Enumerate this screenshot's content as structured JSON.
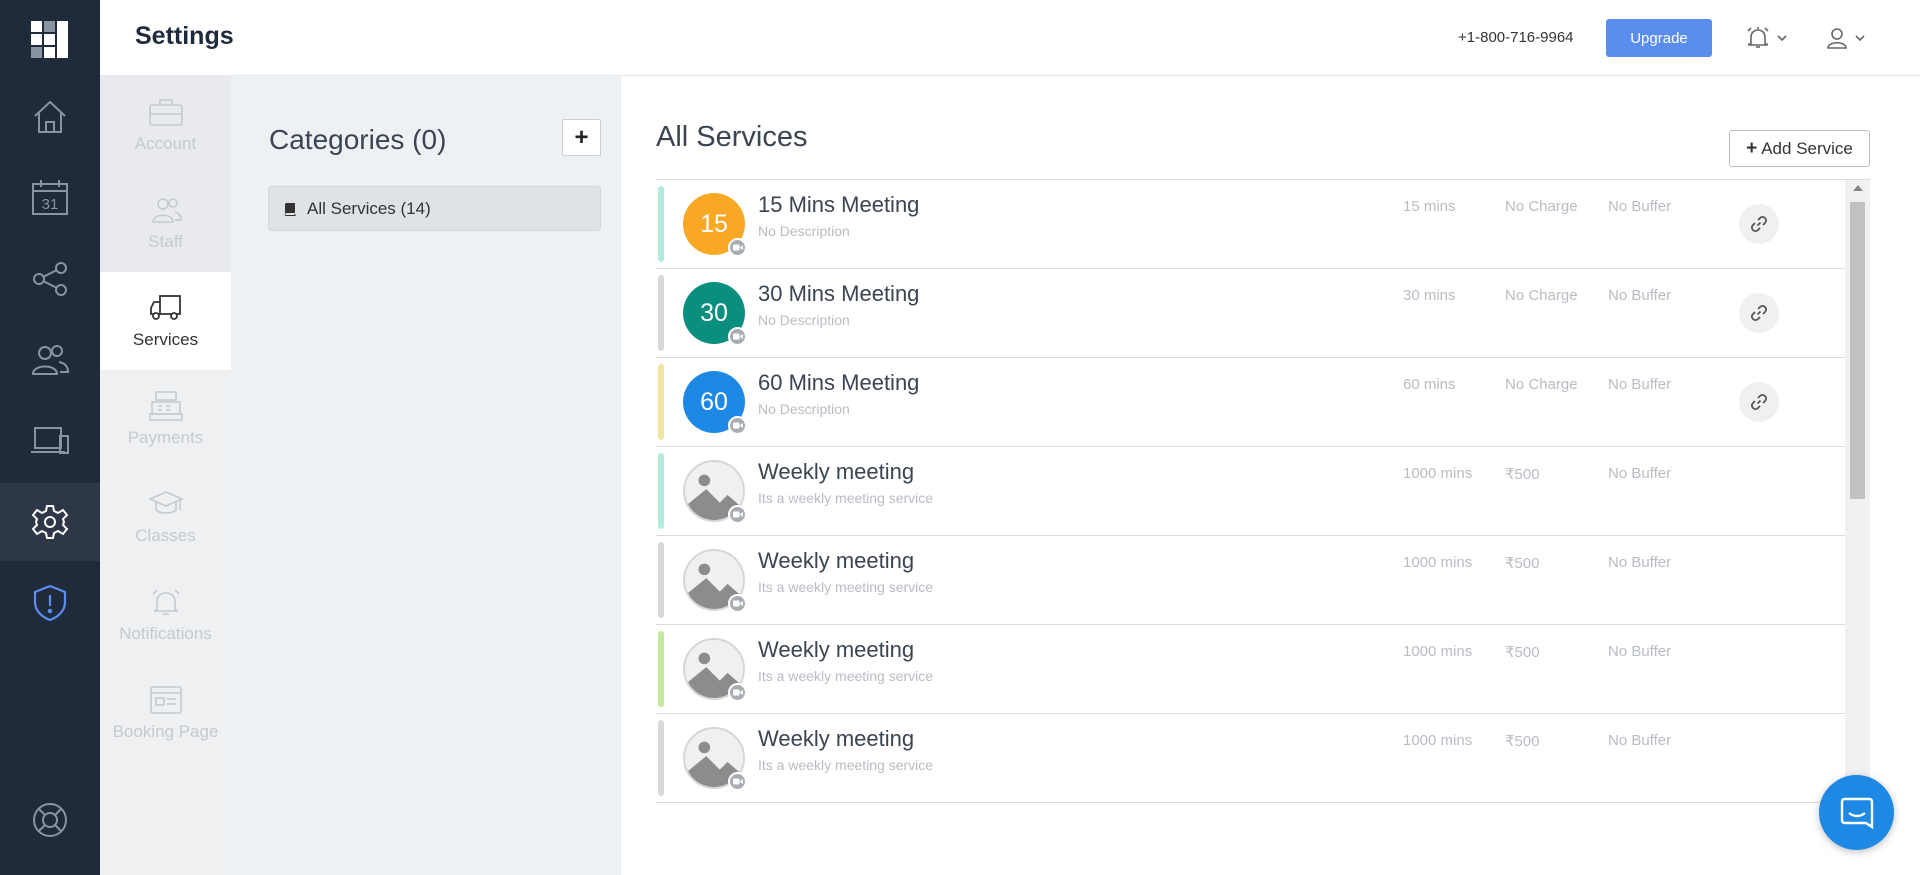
{
  "header": {
    "title": "Settings",
    "phone": "+1-800-716-9964",
    "upgrade_label": "Upgrade"
  },
  "leftnav": {
    "items": [
      "home",
      "calendar",
      "share",
      "customers",
      "devices",
      "settings",
      "security"
    ],
    "active": "settings",
    "calendar_date": "31"
  },
  "subnav": {
    "items": [
      {
        "label": "Account",
        "icon": "briefcase-icon"
      },
      {
        "label": "Staff",
        "icon": "staff-icon"
      },
      {
        "label": "Services",
        "icon": "truck-icon"
      },
      {
        "label": "Payments",
        "icon": "cash-register-icon"
      },
      {
        "label": "Classes",
        "icon": "graduation-cap-icon"
      },
      {
        "label": "Notifications",
        "icon": "bell-icon"
      },
      {
        "label": "Booking Page",
        "icon": "booking-page-icon"
      }
    ],
    "active": "Services"
  },
  "categories": {
    "title": "Categories (0)",
    "add_label": "+",
    "items": [
      {
        "label": "All Services (14)"
      }
    ]
  },
  "services": {
    "title": "All Services",
    "add_label": "Add Service",
    "add_prefix": "+",
    "rows": [
      {
        "avatar_text": "15",
        "avatar_color": "#f9a825",
        "bar_color": "#b2ebe0",
        "name": "15 Mins Meeting",
        "desc": "No Description",
        "duration": "15 mins",
        "price": "No Charge",
        "buffer": "No Buffer",
        "has_link": true
      },
      {
        "avatar_text": "30",
        "avatar_color": "#0a8f7e",
        "bar_color": "#d9d9d9",
        "name": "30 Mins Meeting",
        "desc": "No Description",
        "duration": "30 mins",
        "price": "No Charge",
        "buffer": "No Buffer",
        "has_link": true
      },
      {
        "avatar_text": "60",
        "avatar_color": "#1e88e5",
        "bar_color": "#f0e6a0",
        "name": "60 Mins Meeting",
        "desc": "No Description",
        "duration": "60 mins",
        "price": "No Charge",
        "buffer": "No Buffer",
        "has_link": true
      },
      {
        "avatar_text": "",
        "avatar_color": "",
        "bar_color": "#b2ebe0",
        "name": "Weekly meeting",
        "desc": "Its a weekly meeting service",
        "duration": "1000 mins",
        "price": "₹500",
        "buffer": "No Buffer",
        "has_link": false
      },
      {
        "avatar_text": "",
        "avatar_color": "",
        "bar_color": "#d9d9d9",
        "name": "Weekly meeting",
        "desc": "Its a weekly meeting service",
        "duration": "1000 mins",
        "price": "₹500",
        "buffer": "No Buffer",
        "has_link": false
      },
      {
        "avatar_text": "",
        "avatar_color": "",
        "bar_color": "#c5e89a",
        "name": "Weekly meeting",
        "desc": "Its a weekly meeting service",
        "duration": "1000 mins",
        "price": "₹500",
        "buffer": "No Buffer",
        "has_link": false
      },
      {
        "avatar_text": "",
        "avatar_color": "",
        "bar_color": "#d9d9d9",
        "name": "Weekly meeting",
        "desc": "Its a weekly meeting service",
        "duration": "1000 mins",
        "price": "₹500",
        "buffer": "No Buffer",
        "has_link": false
      }
    ]
  },
  "colors": {
    "nav_bg": "#1f2a3b",
    "accent": "#5b8def",
    "chat": "#1e88e5"
  }
}
